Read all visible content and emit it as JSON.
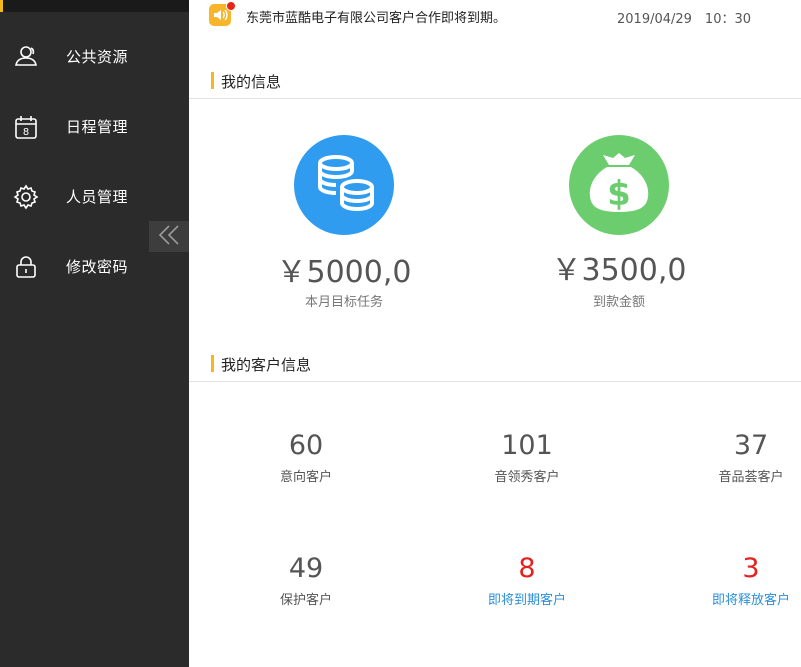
{
  "sidebar": {
    "items": [
      {
        "label": "公共资源",
        "icon": "users-icon"
      },
      {
        "label": "日程管理",
        "icon": "calendar-icon"
      },
      {
        "label": "人员管理",
        "icon": "gear-icon"
      },
      {
        "label": "修改密码",
        "icon": "lock-icon"
      }
    ],
    "calendar_day": "8",
    "collapse_icon": "double-chevron-left-icon"
  },
  "notice": {
    "text": "东莞市蓝酷电子有限公司客户合作即将到期。",
    "time": "2019/04/29　10：30"
  },
  "my_info": {
    "title": "我的信息",
    "target": {
      "value": "￥5000,0",
      "label": "本月目标任务",
      "icon": "coins-icon",
      "color": "#2f9cf0"
    },
    "received": {
      "value": "￥3500,0",
      "label": "到款金额",
      "icon": "money-bag-icon",
      "color": "#6bcd6e"
    }
  },
  "customers": {
    "title": "我的客户信息",
    "stats": [
      {
        "value": "60",
        "label": "意向客户"
      },
      {
        "value": "101",
        "label": "音领秀客户"
      },
      {
        "value": "37",
        "label": "音品荟客户"
      },
      {
        "value": "49",
        "label": "保护客户"
      },
      {
        "value": "8",
        "label": "即将到期客户"
      },
      {
        "value": "3",
        "label": "即将释放客户"
      }
    ]
  },
  "colors": {
    "accent": "#f5b81a",
    "alert": "#e3221f",
    "link": "#2a8fd8"
  }
}
